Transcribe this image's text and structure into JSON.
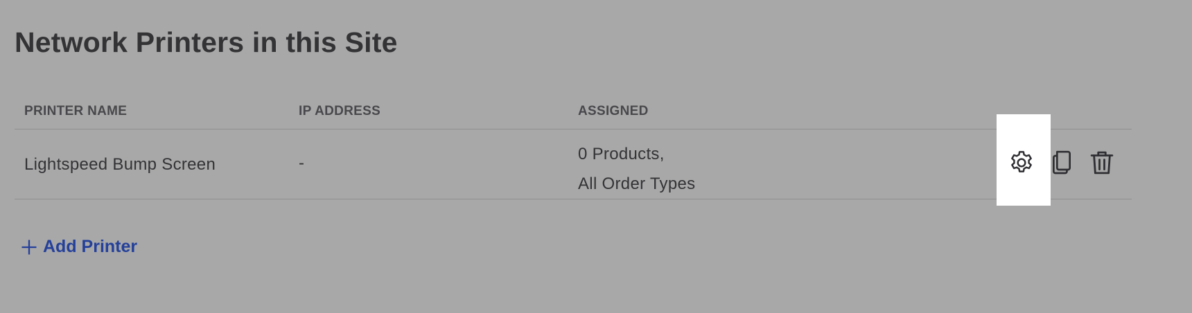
{
  "page": {
    "title": "Network Printers in this Site"
  },
  "table": {
    "headers": {
      "name": "PRINTER NAME",
      "ip": "IP ADDRESS",
      "assigned": "ASSIGNED"
    },
    "rows": [
      {
        "name": "Lightspeed Bump Screen",
        "ip": "-",
        "assigned_line1": "0 Products,",
        "assigned_line2": "All Order Types",
        "actions": [
          "gear-icon",
          "copy-icon",
          "trash-icon"
        ]
      }
    ]
  },
  "add_printer": {
    "label": "Add Printer",
    "icon": "plus-icon"
  },
  "colors": {
    "background": "#a8a8a8",
    "text": "#333336",
    "link": "#24409a",
    "highlight": "#ffffff"
  }
}
